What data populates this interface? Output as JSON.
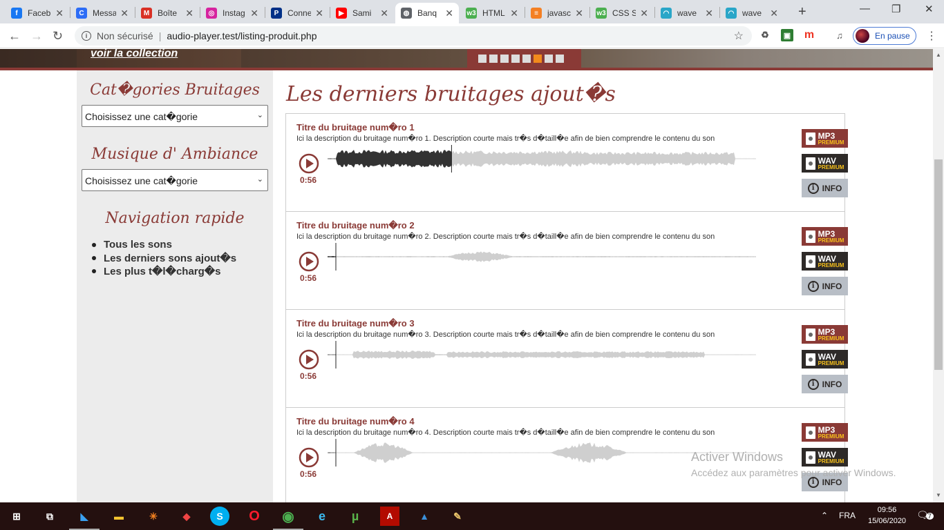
{
  "browser": {
    "tabs": [
      {
        "title": "Faceb",
        "icon": "facebook-icon",
        "color": "#1877f2",
        "glyph": "f"
      },
      {
        "title": "Messa",
        "icon": "messenger-icon",
        "color": "#2d6df6",
        "glyph": "C"
      },
      {
        "title": "Boîte",
        "icon": "gmail-icon",
        "color": "#d93025",
        "glyph": "M"
      },
      {
        "title": "Instag",
        "icon": "instagram-icon",
        "color": "#d6249f",
        "glyph": "◎"
      },
      {
        "title": "Conne",
        "icon": "paypal-icon",
        "color": "#003087",
        "glyph": "P"
      },
      {
        "title": "Sami",
        "icon": "youtube-icon",
        "color": "#ff0000",
        "glyph": "▶"
      },
      {
        "title": "Banq",
        "icon": "globe-icon",
        "color": "#5f6368",
        "glyph": "◍"
      },
      {
        "title": "HTML",
        "icon": "w3schools-icon",
        "color": "#4caf50",
        "glyph": "w3"
      },
      {
        "title": "javasc",
        "icon": "stackoverflow-icon",
        "color": "#f48024",
        "glyph": "≡"
      },
      {
        "title": "CSS S",
        "icon": "w3schools-icon",
        "color": "#4caf50",
        "glyph": "w3"
      },
      {
        "title": "wave",
        "icon": "wavesurfer-icon",
        "color": "#2aa6c8",
        "glyph": "◠"
      },
      {
        "title": "wave",
        "icon": "wavesurfer-icon",
        "color": "#2aa6c8",
        "glyph": "◠"
      }
    ],
    "active_tab": 6,
    "address": {
      "security": "Non sécurisé",
      "url": "audio-player.test/listing-produit.php"
    },
    "profile_label": "En pause"
  },
  "banner": {
    "cta": "voir la collection",
    "dot_count": 8,
    "active_dot": 5,
    "accent_color": "#8a3a36",
    "active_dot_color": "#f28a1c"
  },
  "sidebar": {
    "categories_title": "Cat�gories Bruitages",
    "categories_select": "Choisissez une cat�gorie",
    "ambiance_title": "Musique d' Ambiance",
    "ambiance_select": "Choisissez une cat�gorie",
    "nav_title": "Navigation rapide",
    "nav_links": [
      "Tous les sons",
      "Les derniers sons ajout�s",
      "Les plus t�l�charg�s"
    ]
  },
  "main": {
    "title": "Les derniers bruitages ajout�s",
    "download": {
      "mp3": "MP3",
      "wav": "WAV",
      "premium": "PREMIUM",
      "info": "INFO"
    },
    "sounds": [
      {
        "title": "Titre du bruitage num�ro 1",
        "description": "Ici la description du bruitage num�ro 1. Description courte mais tr�s d�taill�e afin de bien comprendre le contenu du son",
        "duration": "0:56",
        "progress": 0.27
      },
      {
        "title": "Titre du bruitage num�ro 2",
        "description": "Ici la description du bruitage num�ro 2. Description courte mais tr�s d�taill�e afin de bien comprendre le contenu du son",
        "duration": "0:56",
        "progress": 0
      },
      {
        "title": "Titre du bruitage num�ro 3",
        "description": "Ici la description du bruitage num�ro 3. Description courte mais tr�s d�taill�e afin de bien comprendre le contenu du son",
        "duration": "0:56",
        "progress": 0
      },
      {
        "title": "Titre du bruitage num�ro 4",
        "description": "Ici la description du bruitage num�ro 4. Description courte mais tr�s d�taill�e afin de bien comprendre le contenu du son",
        "duration": "0:56",
        "progress": 0
      }
    ]
  },
  "watermark": {
    "line1": "Activer Windows",
    "line2": "Accédez aux paramètres pour activer Windows."
  },
  "taskbar": {
    "language": "FRA",
    "time": "09:56",
    "date": "15/06/2020",
    "notifications": "7"
  }
}
